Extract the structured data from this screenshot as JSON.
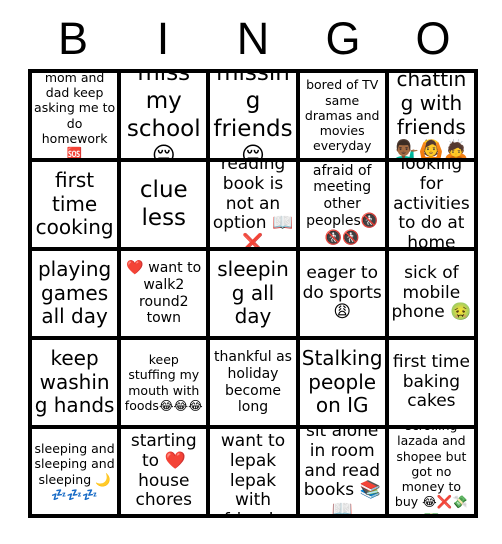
{
  "header": {
    "letters": [
      "B",
      "I",
      "N",
      "G",
      "O"
    ]
  },
  "grid": {
    "rows": [
      [
        {
          "text": "mom and dad keep asking me to do homework🆘",
          "size": "fs-xs"
        },
        {
          "text": "miss my school 😔",
          "size": "fs-xl"
        },
        {
          "text": "missing friends 😔",
          "size": "fs-xl"
        },
        {
          "text": "bored of TV same dramas and movies everyday",
          "size": "fs-xs"
        },
        {
          "text": "chatting with friends💁🏾‍♂️🙆🙇",
          "size": "fs-lg"
        }
      ],
      [
        {
          "text": "first time cooking",
          "size": "fs-lg"
        },
        {
          "text": "clue less",
          "size": "fs-xl"
        },
        {
          "text": "reading book is not an option 📖❌",
          "size": "fs-md"
        },
        {
          "text": "afraid of meeting other peoples🚷🚷🚷",
          "size": "fs-sm"
        },
        {
          "text": "looking for activities to do at home",
          "size": "fs-md"
        }
      ],
      [
        {
          "text": "playing games all day",
          "size": "fs-lg"
        },
        {
          "text": "❤️ want to walk2 round2 town",
          "size": "fs-sm"
        },
        {
          "text": "sleeping all day",
          "size": "fs-lg"
        },
        {
          "text": "eager to do sports 😩",
          "size": "fs-md"
        },
        {
          "text": "sick of mobile phone 🤢",
          "size": "fs-md"
        }
      ],
      [
        {
          "text": "keep washing hands",
          "size": "fs-lg"
        },
        {
          "text": "keep stuffing my mouth with foods😂😂😂",
          "size": "fs-xs"
        },
        {
          "text": "thankful as holiday become long",
          "size": "fs-sm"
        },
        {
          "text": "Stalking people on IG",
          "size": "fs-lg"
        },
        {
          "text": "first time baking cakes",
          "size": "fs-md"
        }
      ],
      [
        {
          "text": "sleeping and sleeping and sleeping 🌙💤💤💤",
          "size": "fs-xs"
        },
        {
          "text": "starting to ❤️ house chores",
          "size": "fs-md"
        },
        {
          "text": "heart want to lepak lepak with friends",
          "size": "fs-md"
        },
        {
          "text": "sit alone in room and read books 📚📖",
          "size": "fs-md"
        },
        {
          "text": "scrolling lazada and shopee but got no money to buy 😂❌💸💵",
          "size": "fs-xs"
        }
      ]
    ]
  },
  "colors": {
    "background": "#ffffff",
    "grid_line": "#000000",
    "text": "#000000"
  }
}
